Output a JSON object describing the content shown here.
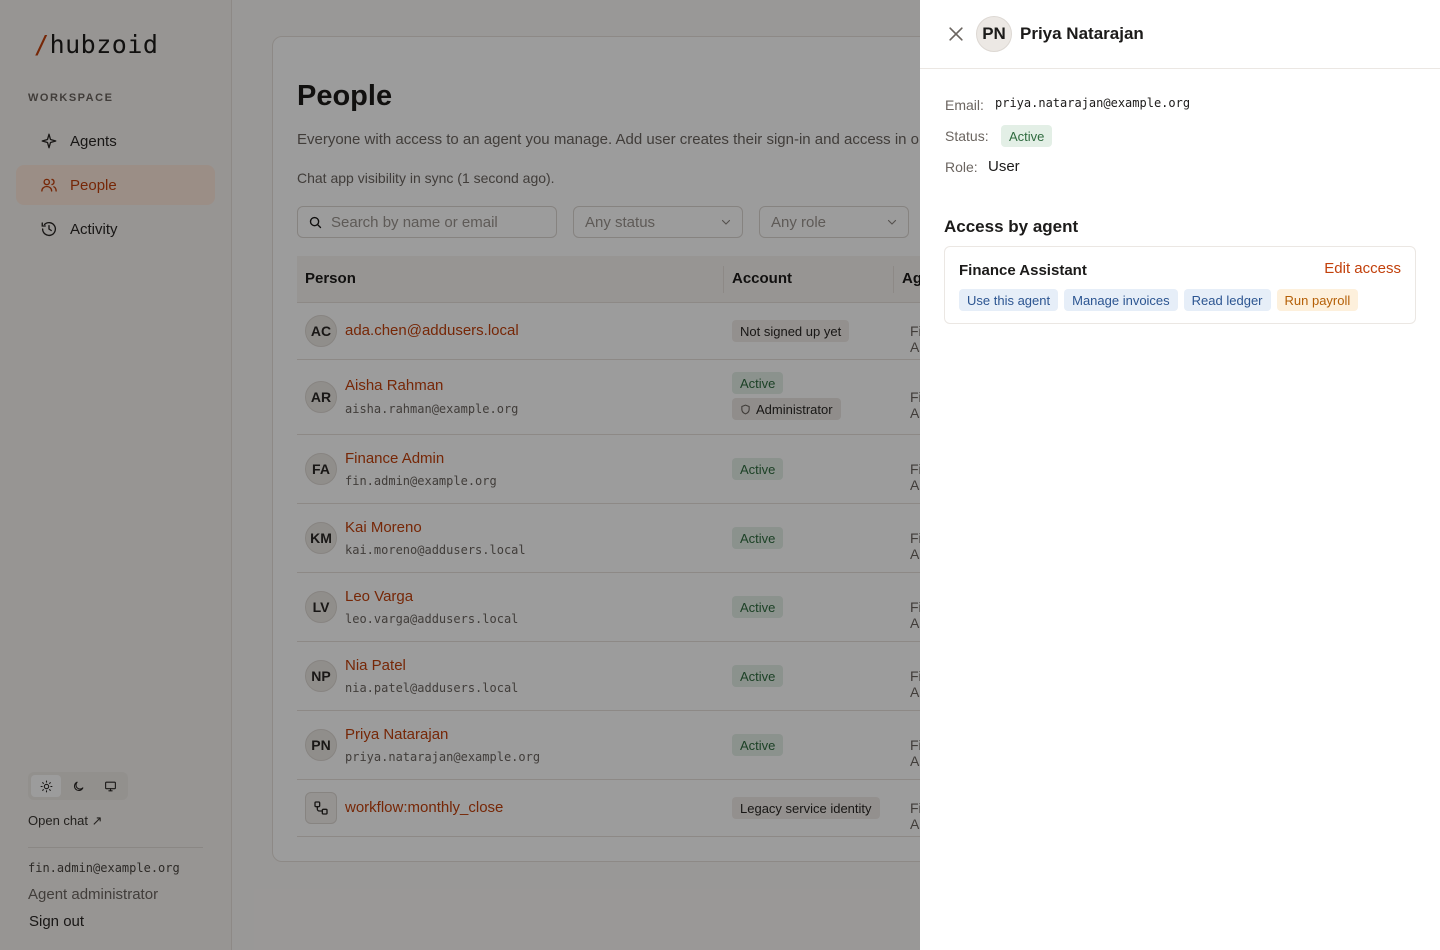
{
  "brand": {
    "slash": "/",
    "name": "hubzoid",
    "accent": "#c2410c"
  },
  "sidebar": {
    "section_label": "WORKSPACE",
    "items": [
      {
        "label": "Agents",
        "icon": "sparkle-icon",
        "active": false
      },
      {
        "label": "People",
        "icon": "users-icon",
        "active": true
      },
      {
        "label": "Activity",
        "icon": "history-icon",
        "active": false
      }
    ],
    "open_chat": "Open chat ↗",
    "user_email": "fin.admin@example.org",
    "user_role": "Agent administrator",
    "sign_out": "Sign out"
  },
  "main": {
    "title": "People",
    "description": "Everyone with access to an agent you manage. Add user creates their sign-in and access in one step.",
    "sync_status": "Chat app visibility in sync (1 second ago).",
    "search_placeholder": "Search by name or email",
    "status_filter": "Any status",
    "role_filter": "Any role",
    "columns": [
      "Person",
      "Account",
      "Agents"
    ],
    "rows": [
      {
        "initials": "AC",
        "name": "ada.chen@addusers.local",
        "email": "",
        "badges": [
          "Not signed up yet"
        ],
        "agent": "Finance Assistant"
      },
      {
        "initials": "AR",
        "name": "Aisha Rahman",
        "email": "aisha.rahman@example.org",
        "badges": [
          "Active"
        ],
        "admin": "Administrator",
        "agent": "Finance Assistant"
      },
      {
        "initials": "FA",
        "name": "Finance Admin",
        "email": "fin.admin@example.org",
        "badges": [
          "Active"
        ],
        "agent": "Finance Assistant"
      },
      {
        "initials": "KM",
        "name": "Kai Moreno",
        "email": "kai.moreno@addusers.local",
        "badges": [
          "Active"
        ],
        "agent": "Finance Assistant"
      },
      {
        "initials": "LV",
        "name": "Leo Varga",
        "email": "leo.varga@addusers.local",
        "badges": [
          "Active"
        ],
        "agent": "Finance Assistant"
      },
      {
        "initials": "NP",
        "name": "Nia Patel",
        "email": "nia.patel@addusers.local",
        "badges": [
          "Active"
        ],
        "agent": "Finance Assistant"
      },
      {
        "initials": "PN",
        "name": "Priya Natarajan",
        "email": "priya.natarajan@example.org",
        "badges": [
          "Active"
        ],
        "agent": "Finance Assistant"
      },
      {
        "initials": "",
        "name": "workflow:monthly_close",
        "email": "",
        "badges": [
          "Legacy service identity"
        ],
        "agent": "Finance Assistant"
      }
    ]
  },
  "drawer": {
    "initials": "PN",
    "name": "Priya Natarajan",
    "email_label": "Email:",
    "email": "priya.natarajan@example.org",
    "status_label": "Status:",
    "status": "Active",
    "role_label": "Role:",
    "role": "User",
    "section_title": "Access by agent",
    "agent": "Finance Assistant",
    "edit_access": "Edit access",
    "permissions": [
      {
        "label": "Use this agent",
        "tone": "blue"
      },
      {
        "label": "Manage invoices",
        "tone": "blue"
      },
      {
        "label": "Read ledger",
        "tone": "blue"
      },
      {
        "label": "Run payroll",
        "tone": "amber"
      }
    ]
  }
}
